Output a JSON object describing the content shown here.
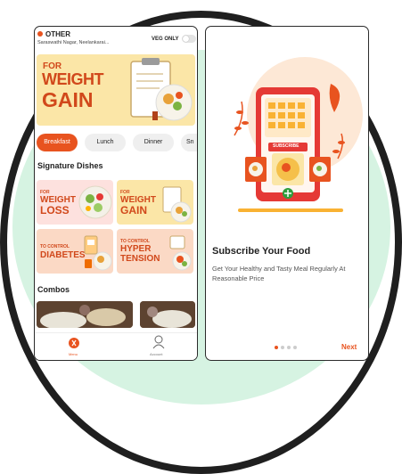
{
  "left_screen": {
    "location": {
      "title": "OTHER",
      "address": "Saraswathi Nagar, Neelankarai...",
      "veg_only_label": "VEG ONLY"
    },
    "banner": {
      "line1": "FOR",
      "line2": "WEIGHT",
      "line3": "GAIN"
    },
    "categories": [
      "Breakfast",
      "Lunch",
      "Dinner",
      "Sn"
    ],
    "active_category": "Breakfast",
    "signature_title": "Signature Dishes",
    "dishes": [
      {
        "small": "FOR",
        "big1": "WEIGHT",
        "big2": "LOSS"
      },
      {
        "small": "FOR",
        "big1": "WEIGHT",
        "big2": "GAIN"
      },
      {
        "small": "TO CONTROL",
        "big1": "DIABETES",
        "big2": ""
      },
      {
        "small": "TO CONTROL",
        "big1": "HYPER",
        "big2": "TENSION"
      }
    ],
    "combos_title": "Combos",
    "tabs": [
      "Menu",
      "Account"
    ]
  },
  "right_screen": {
    "phone_badge": "SUBSCRIBE",
    "title": "Subscribe Your Food",
    "description": "Get Your Healthy and Tasty Meal Regularly At Reasonable Price",
    "next_label": "Next",
    "page_count": 4,
    "active_page": 1
  },
  "colors": {
    "accent": "#e8531f",
    "mint_background": "#d6f3e2",
    "banner_yellow": "#fbe6a7",
    "green_plus": "#2e9e3d"
  }
}
